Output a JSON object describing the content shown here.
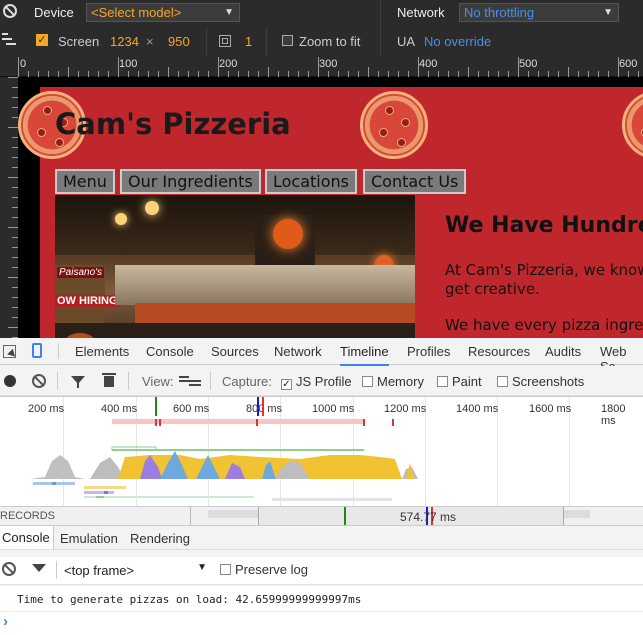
{
  "device_toolbar": {
    "device_label": "Device",
    "device_select": "<Select model>",
    "network_label": "Network",
    "network_select": "No throttling",
    "screen_label": "Screen",
    "screen_width": "1234",
    "screen_x": "×",
    "screen_height": "950",
    "scale_value": "1",
    "zoom_to_fit_label": "Zoom to fit",
    "ua_label": "UA",
    "ua_value": "No override"
  },
  "ruler": {
    "labels": [
      "0",
      "100",
      "200",
      "300",
      "400",
      "500",
      "600"
    ]
  },
  "site": {
    "title": "Cam's Pizzeria",
    "nav": [
      "Menu",
      "Our Ingredients",
      "Locations",
      "Contact Us"
    ],
    "photo_sign_1": "Paisano's",
    "photo_sign_2": "OW HIRING",
    "hero_heading": "We Have Hundreds",
    "hero_p1_line1": "At Cam's Pizzeria, we know",
    "hero_p1_line2": "get creative.",
    "hero_p2": "We have every pizza ingredient"
  },
  "devtools": {
    "tabs": [
      "Elements",
      "Console",
      "Sources",
      "Network",
      "Timeline",
      "Profiles",
      "Resources",
      "Audits",
      "Web Sc"
    ],
    "active_tab": "Timeline",
    "timeline_toolbar": {
      "view_label": "View:",
      "capture_label": "Capture:",
      "js_profile": "JS Profile",
      "memory": "Memory",
      "paint": "Paint",
      "screenshots": "Screenshots"
    },
    "timeline_ticks": [
      "200 ms",
      "400 ms",
      "600 ms",
      "800 ms",
      "1000 ms",
      "1200 ms",
      "1400 ms",
      "1600 ms",
      "1800 ms"
    ],
    "overview_left": "RECORDS",
    "overview_time": "574.77 ms",
    "drawer_tabs": [
      "Console",
      "Emulation",
      "Rendering"
    ],
    "frame_select": "<top frame>",
    "preserve_log": "Preserve log",
    "console_message": "Time to generate pizzas on load: 42.65999999999997ms",
    "prompt": "›"
  },
  "colors": {
    "toolbar_bg": "#2b2b2b",
    "accent_orange": "#f5a623",
    "accent_blue": "#4a90e2",
    "site_red": "#c0272d",
    "devtools_active": "#3e82f7",
    "chart_yellow": "#f1c232",
    "chart_purple": "#9b7fe0",
    "chart_blue": "#6fa8dc",
    "chart_gray": "#b7b7b7"
  }
}
